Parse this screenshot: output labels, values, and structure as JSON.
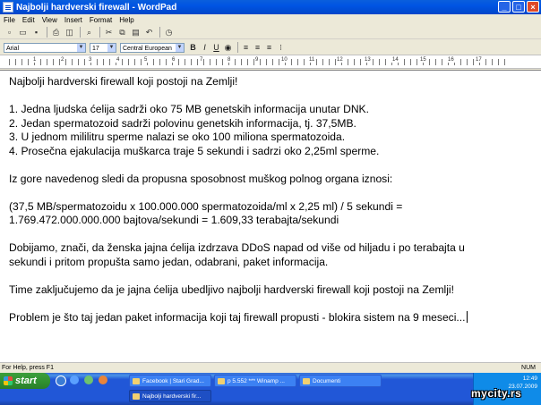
{
  "window": {
    "title": "Najbolji hardverski firewall - WordPad"
  },
  "menu": [
    "File",
    "Edit",
    "View",
    "Insert",
    "Format",
    "Help"
  ],
  "format_bar": {
    "font": "Arial",
    "size": "17",
    "script": "Central European",
    "bold": "B",
    "italic": "I",
    "underline": "U"
  },
  "ruler": [
    "1",
    "2",
    "3",
    "4",
    "5",
    "6",
    "7",
    "8",
    "9",
    "10",
    "11",
    "12",
    "13",
    "14",
    "15",
    "16",
    "17"
  ],
  "document": {
    "lines": [
      "Najbolji hardverski firewall koji postoji na Zemlji!",
      "",
      "1. Jedna ljudska ćelija sadrži oko 75 MB genetskih informacija unutar DNK.",
      "2. Jedan spermatozoid sadrži polovinu genetskih informacija, tj. 37,5MB.",
      "3. U jednom mililitru sperme nalazi se oko 100 miliona spermatozoida.",
      "4. Prosečna ejakulacija muškarca traje 5 sekundi i sadrzi oko 2,25ml sperme.",
      "",
      "Iz gore navedenog sledi da propusna sposobnost muškog polnog organa iznosi:",
      "",
      "(37,5 MB/spermatozoidu x 100.000.000 spermatozoida/ml x 2,25 ml) / 5 sekundi =",
      "1.769.472.000.000.000 bajtova/sekundi = 1.609,33 terabajta/sekundi",
      "",
      "Dobijamo, znači, da ženska jajna ćelija izdrzava DDoS napad od više od hiljadu i po terabajta u",
      "sekundi i pritom propušta samo jedan, odabrani, paket informacija.",
      "",
      "Time zaključujemo da je jajna ćelija ubedljivo najbolji hardverski firewall koji postoji na Zemlji!",
      "",
      "Problem je što taj jedan paket informacija koji taj firewall propusti - blokira sistem na 9 meseci..."
    ]
  },
  "status_bar": {
    "help": "For Help, press F1",
    "num": "NUM"
  },
  "taskbar": {
    "start": "start",
    "tasks": [
      {
        "label": "Facebook | Stari Grad...",
        "active": false
      },
      {
        "label": "p 5.552 *** Winamp ...",
        "active": false
      },
      {
        "label": "Documenti",
        "active": false
      },
      {
        "label": "Najbolji hardverski fir...",
        "active": true
      }
    ],
    "clock": "12:49",
    "date": "23.07.2009"
  },
  "watermark": "mycity.rs"
}
